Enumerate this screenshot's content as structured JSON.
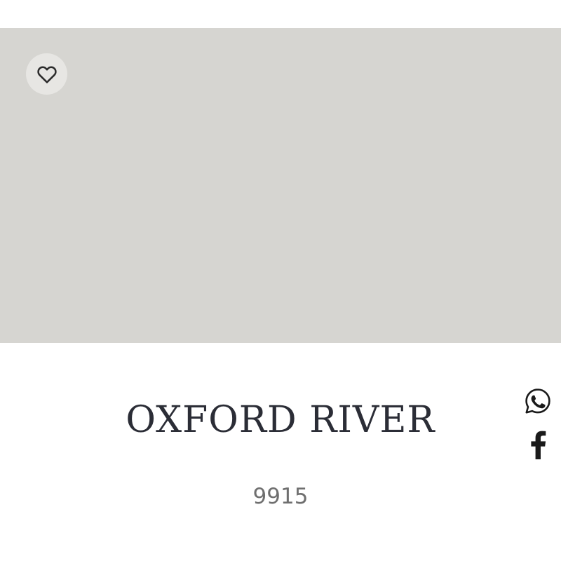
{
  "swatch": {
    "color": "#d6d5d1"
  },
  "favorite": {
    "icon": "heart-outline-icon"
  },
  "product": {
    "name": "OXFORD RIVER",
    "code": "9915"
  },
  "share": {
    "whatsapp_icon": "whatsapp-icon",
    "facebook_icon": "facebook-icon"
  }
}
